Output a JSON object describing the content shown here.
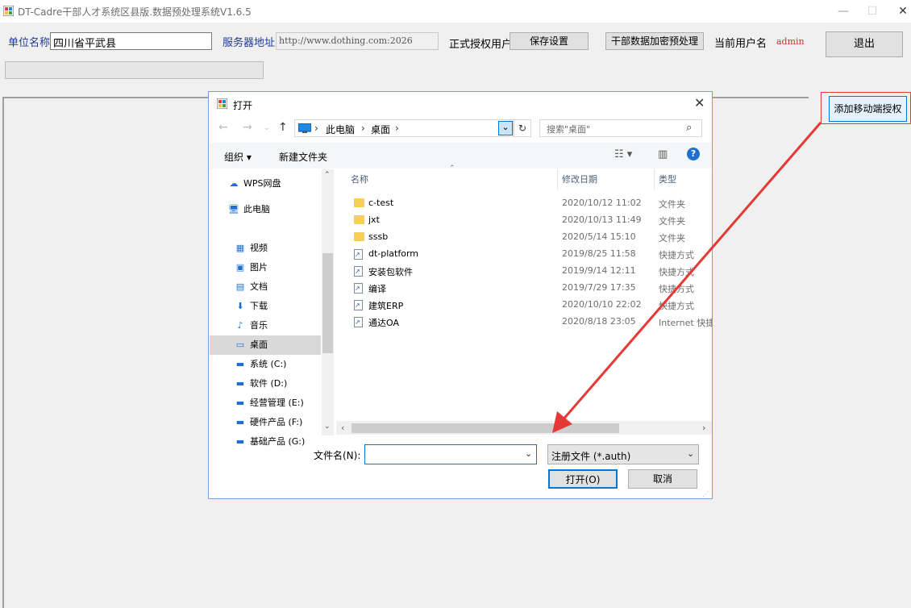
{
  "window": {
    "title": "DT-Cadre干部人才系统区县版.数据预处理系统V1.6.5",
    "minimize": "—",
    "maximize": "☐",
    "close": "✕"
  },
  "form": {
    "unit_label": "单位名称",
    "unit_value": "四川省平武县",
    "server_label": "服务器地址",
    "server_value": "http://www.dothing.com:2026",
    "license_label": "正式授权用户",
    "save_button": "保存设置",
    "encrypt_button": "干部数据加密预处理",
    "current_user_label": "当前用户名",
    "current_user": "admin",
    "exit_button": "退出",
    "mobile_auth_button": "添加移动端授权"
  },
  "dialog": {
    "title": "打开",
    "close": "✕",
    "breadcrumb": [
      "此电脑",
      "桌面"
    ],
    "search_placeholder": "搜索\"桌面\"",
    "organize": "组织 ▾",
    "new_folder": "新建文件夹",
    "sidebar": [
      {
        "label": "WPS网盘",
        "icon": "cloud-icon",
        "glyph": "☁"
      },
      {
        "label": "此电脑",
        "icon": "computer-icon",
        "glyph": "🖥"
      },
      {
        "label": "视频",
        "icon": "video-icon",
        "glyph": "▦"
      },
      {
        "label": "图片",
        "icon": "picture-icon",
        "glyph": "▣"
      },
      {
        "label": "文档",
        "icon": "document-icon",
        "glyph": "▤"
      },
      {
        "label": "下载",
        "icon": "download-icon",
        "glyph": "⬇"
      },
      {
        "label": "音乐",
        "icon": "music-icon",
        "glyph": "♪"
      },
      {
        "label": "桌面",
        "icon": "desktop-icon",
        "glyph": "▭"
      },
      {
        "label": "系统 (C:)",
        "icon": "drive-icon",
        "glyph": "▬"
      },
      {
        "label": "软件 (D:)",
        "icon": "drive-icon",
        "glyph": "▬"
      },
      {
        "label": "经营管理 (E:)",
        "icon": "drive-icon",
        "glyph": "▬"
      },
      {
        "label": "硬件产品 (F:)",
        "icon": "drive-icon",
        "glyph": "▬"
      },
      {
        "label": "基础产品 (G:)",
        "icon": "drive-icon",
        "glyph": "▬"
      }
    ],
    "selected_sidebar": "桌面",
    "columns": {
      "name": "名称",
      "date": "修改日期",
      "type": "类型"
    },
    "files": [
      {
        "name": "c-test",
        "date": "2020/10/12 11:02",
        "type": "文件夹",
        "kind": "folder"
      },
      {
        "name": "jxt",
        "date": "2020/10/13 11:49",
        "type": "文件夹",
        "kind": "folder"
      },
      {
        "name": "sssb",
        "date": "2020/5/14 15:10",
        "type": "文件夹",
        "kind": "folder"
      },
      {
        "name": "dt-platform",
        "date": "2019/8/25 11:58",
        "type": "快捷方式",
        "kind": "shortcut"
      },
      {
        "name": "安装包软件",
        "date": "2019/9/14 12:11",
        "type": "快捷方式",
        "kind": "shortcut"
      },
      {
        "name": "编译",
        "date": "2019/7/29 17:35",
        "type": "快捷方式",
        "kind": "shortcut"
      },
      {
        "name": "建筑ERP",
        "date": "2020/10/10 22:02",
        "type": "快捷方式",
        "kind": "shortcut"
      },
      {
        "name": "通达OA",
        "date": "2020/8/18 23:05",
        "type": "Internet 快捷",
        "kind": "shortcut"
      }
    ],
    "filename_label": "文件名(N):",
    "filename_value": "",
    "filetype": "注册文件 (*.auth)",
    "open_button": "打开(O)",
    "cancel_button": "取消"
  },
  "colors": {
    "accent": "#0078d7",
    "annotation": "#e53935",
    "admin": "#c0392b",
    "label_blue": "#1f3a93"
  }
}
